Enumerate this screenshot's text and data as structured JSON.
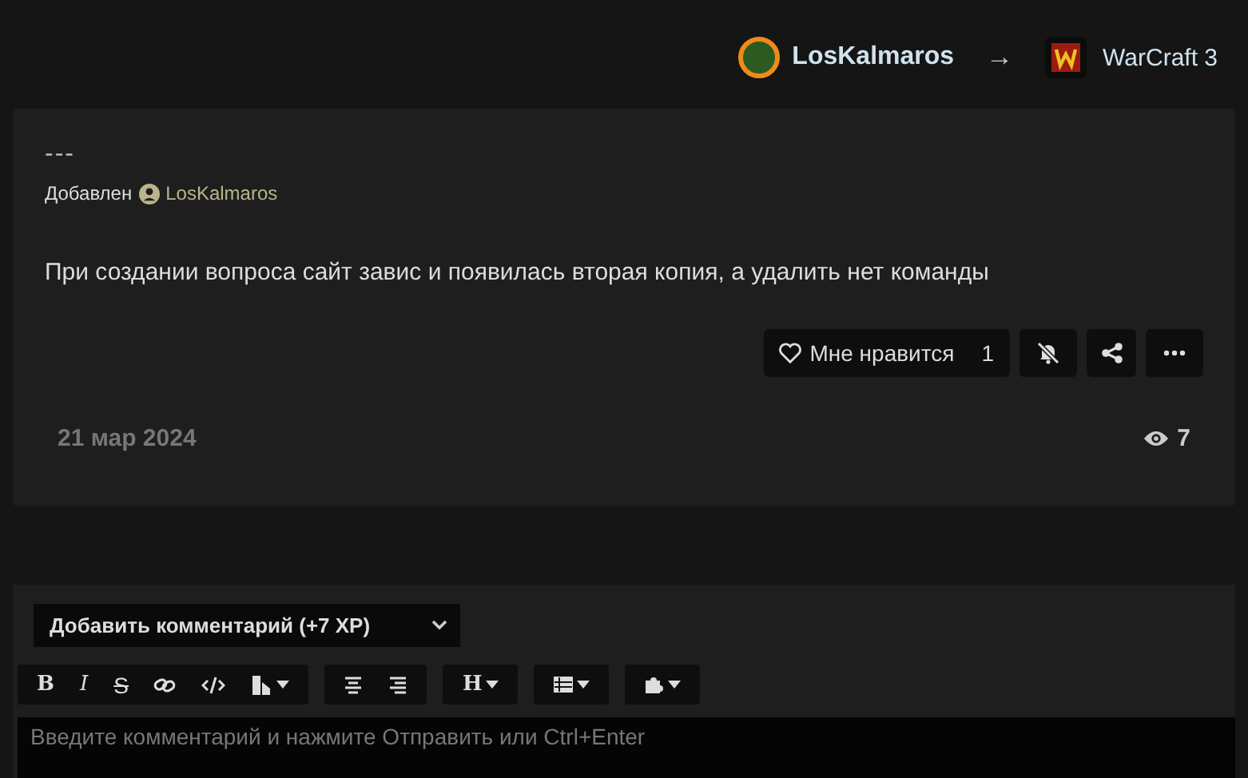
{
  "header": {
    "author": "LosKalmaros",
    "arrow": "→",
    "target": "WarCraft 3"
  },
  "post": {
    "title": "---",
    "added_label": "Добавлен",
    "added_by": "LosKalmaros",
    "body": "При создании вопроса сайт завис и появилась вторая копия, а удалить нет команды",
    "like_label": "Мне нравится",
    "like_count": "1",
    "date": "21 мар 2024",
    "views": "7"
  },
  "comment": {
    "type_select": "Добавить комментарий (+7 XP)",
    "toolbar": [
      [
        {
          "kind": "bold",
          "label": "B",
          "dropdown": false
        },
        {
          "kind": "italic",
          "label": "I",
          "dropdown": false
        },
        {
          "kind": "strike",
          "label": "S",
          "dropdown": false
        },
        {
          "kind": "link",
          "dropdown": false
        },
        {
          "kind": "code",
          "dropdown": false
        },
        {
          "kind": "color",
          "dropdown": true
        }
      ],
      [
        {
          "kind": "align-center",
          "dropdown": false
        },
        {
          "kind": "align-right",
          "dropdown": false
        }
      ],
      [
        {
          "kind": "heading",
          "label": "H",
          "dropdown": true
        }
      ],
      [
        {
          "kind": "table",
          "dropdown": true
        }
      ],
      [
        {
          "kind": "plugin",
          "dropdown": true
        }
      ]
    ],
    "placeholder": "Введите комментарий и нажмите Отправить или Ctrl+Enter"
  }
}
